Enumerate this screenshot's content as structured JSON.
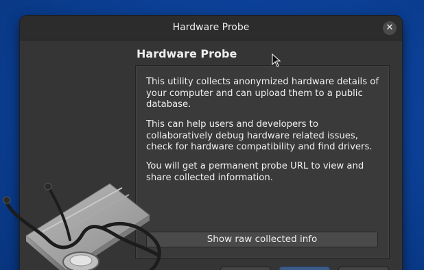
{
  "window": {
    "title": "Hardware Probe",
    "close_glyph": "✕"
  },
  "main": {
    "heading": "Hardware Probe",
    "paragraphs": [
      "This utility collects anonymized hardware details of your computer and can upload them to a public database.",
      "This can help users and developers to collaboratively debug hardware related issues, check for hardware compatibility and find drivers.",
      "You will get a permanent probe URL to view and share collected information."
    ],
    "show_raw_button": "Show raw collected info"
  },
  "icons": {
    "close": "close-icon",
    "illustration": "stethoscope-computer-icon",
    "cursor": "mouse-pointer-icon"
  },
  "colors": {
    "desktop_background": "#0b3f94",
    "window_background": "#353535",
    "titlebar_background": "#2c2c2c"
  }
}
